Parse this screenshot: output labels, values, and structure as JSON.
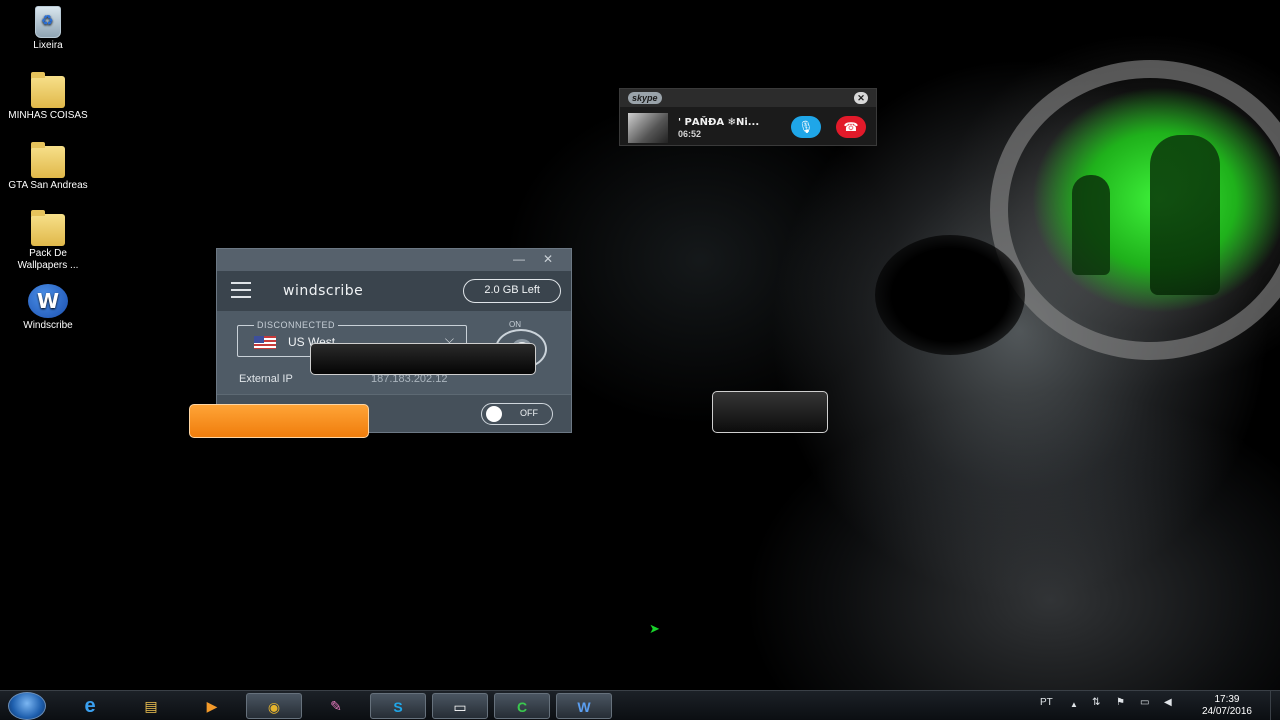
{
  "desktop_icons": [
    {
      "label": "Lixeira",
      "icon": "recycle-bin-icon"
    },
    {
      "label": "MINHAS COISAS",
      "icon": "folder-icon"
    },
    {
      "label": "GTA San Andreas",
      "icon": "folder-icon"
    },
    {
      "label": "Pack De Wallpapers ...",
      "icon": "folder-icon"
    },
    {
      "label": "Windscribe",
      "icon": "windscribe-icon"
    }
  ],
  "skype": {
    "logo": "skype",
    "contact_name": "' ΡΑŇĐΑ ❄Ni...",
    "call_time": "06:52",
    "close_glyph": "✕",
    "mic_glyph": "🎙",
    "hangup_glyph": "☎"
  },
  "windscribe": {
    "brand": "windscribe",
    "data_left": "2.0 GB Left",
    "status": "DISCONNECTED",
    "location": "US West",
    "power_label": "ON",
    "external_ip_label": "External IP",
    "external_ip_value": "187.183.202.12",
    "firewall_state": "OFF",
    "minimize_glyph": "—",
    "close_glyph": "✕",
    "chevron_glyph": "⌵"
  },
  "taskbar": {
    "language": "PT",
    "time": "17:39",
    "date": "24/07/2016",
    "apps": [
      {
        "name": "internet-explorer",
        "glyph": "e"
      },
      {
        "name": "file-explorer",
        "glyph": "▤"
      },
      {
        "name": "media-player",
        "glyph": "▶"
      },
      {
        "name": "chrome",
        "glyph": "◉"
      },
      {
        "name": "paint",
        "glyph": "✎"
      },
      {
        "name": "skype",
        "glyph": "S"
      },
      {
        "name": "command-prompt",
        "glyph": "▭"
      },
      {
        "name": "camtasia",
        "glyph": "C"
      },
      {
        "name": "windscribe",
        "glyph": "W"
      }
    ],
    "tray_up": "▲",
    "tray_network": "⇅",
    "tray_flag": "⚑",
    "tray_monitor": "▭",
    "tray_volume": "◀"
  },
  "colors": {
    "skype_mic": "#1fa6e8",
    "skype_hangup": "#e21a2a",
    "windscribe_bg": "#4f5b66",
    "overlay_orange": "#f7901e",
    "wallpaper_glow": "#3ef23a"
  }
}
